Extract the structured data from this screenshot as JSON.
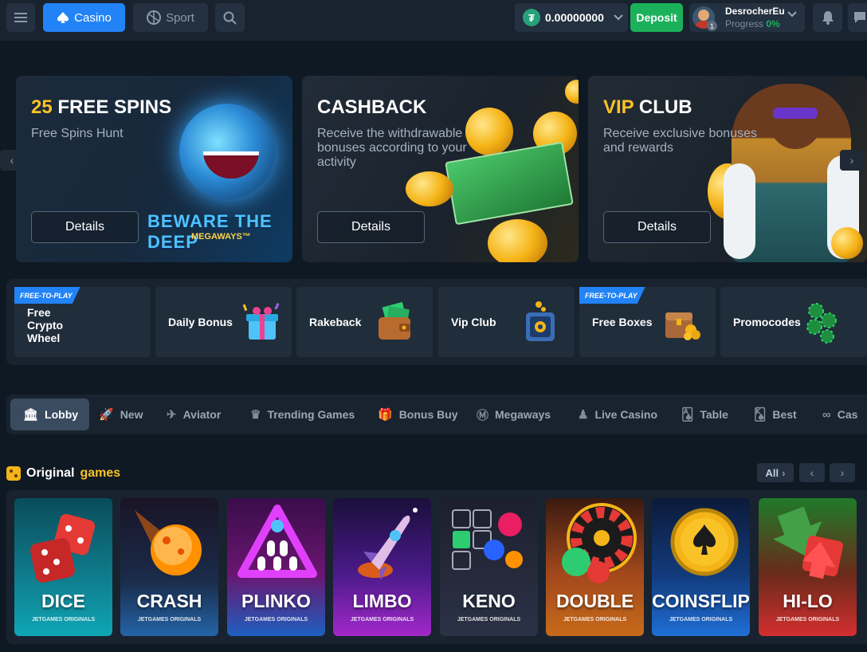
{
  "header": {
    "casino_label": "Casino",
    "sport_label": "Sport",
    "balance": "0.00000000",
    "currency_icon": "usdt-icon",
    "deposit_label": "Deposit",
    "username": "DesrocherEu",
    "progress_label": "Progress",
    "progress_value": "0%",
    "level": "1"
  },
  "promos": [
    {
      "title_accent": "25",
      "title_rest": " FREE SPINS",
      "subtitle": "Free Spins Hunt",
      "button": "Details",
      "art_title": "BEWARE THE DEEP",
      "art_sub": "MEGAWAYS™"
    },
    {
      "title_accent": "",
      "title_rest": "CASHBACK",
      "subtitle": "Receive the withdrawable bonuses according to your activity",
      "button": "Details"
    },
    {
      "title_accent": "VIP",
      "title_rest": " CLUB",
      "subtitle": "Receive exclusive bonuses and rewards",
      "button": "Details"
    }
  ],
  "quick_links": [
    {
      "label": "Free Crypto Wheel",
      "tag": "FREE-TO-PLAY"
    },
    {
      "label": "Daily Bonus",
      "tag": ""
    },
    {
      "label": "Rakeback",
      "tag": ""
    },
    {
      "label": "Vip Club",
      "tag": ""
    },
    {
      "label": "Free Boxes",
      "tag": "FREE-TO-PLAY"
    },
    {
      "label": "Promocodes",
      "tag": ""
    }
  ],
  "categories": [
    "Lobby",
    "New",
    "Aviator",
    "Trending Games",
    "Bonus Buy",
    "Megaways",
    "Live Casino",
    "Table",
    "Best",
    "Cas"
  ],
  "section": {
    "title_white": "Original",
    "title_yellow": "games",
    "all_label": "All"
  },
  "games": [
    {
      "name": "DICE",
      "sub": "JETGAMES ORIGINALS"
    },
    {
      "name": "CRASH",
      "sub": "JETGAMES ORIGINALS"
    },
    {
      "name": "PLINKO",
      "sub": "JETGAMES ORIGINALS"
    },
    {
      "name": "LIMBO",
      "sub": "JETGAMES ORIGINALS"
    },
    {
      "name": "KENO",
      "sub": "JETGAMES ORIGINALS"
    },
    {
      "name": "DOUBLE",
      "sub": "JETGAMES ORIGINALS"
    },
    {
      "name": "COINSFLIP",
      "sub": "JETGAMES ORIGINALS"
    },
    {
      "name": "HI-LO",
      "sub": "JETGAMES ORIGINALS"
    }
  ],
  "colors": {
    "accent": "#2283f6",
    "deposit": "#1bb15a",
    "gold": "#f9c328",
    "bg": "#0f1923"
  }
}
